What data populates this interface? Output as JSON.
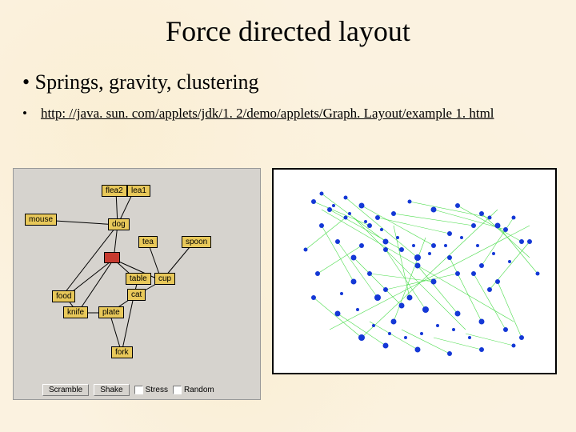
{
  "title": "Force directed layout",
  "bullet_main": "Springs, gravity, clustering",
  "link_text": "http: //java. sun. com/applets/jdk/1. 2/demo/applets/Graph. Layout/example 1. html",
  "applet": {
    "buttons": {
      "scramble": "Scramble",
      "shake": "Shake"
    },
    "checks": {
      "stress": "Stress",
      "random": "Random"
    },
    "nodes": {
      "flea2": "flea2",
      "flea1": "lea1",
      "mouse": "mouse",
      "dog": "dog",
      "tea": "tea",
      "spoon": "spoon",
      "cup": "cup",
      "table": "table",
      "cat": "cat",
      "food": "food",
      "knife": "knife",
      "plate": "plate",
      "fork": "fork",
      "center": ""
    }
  }
}
